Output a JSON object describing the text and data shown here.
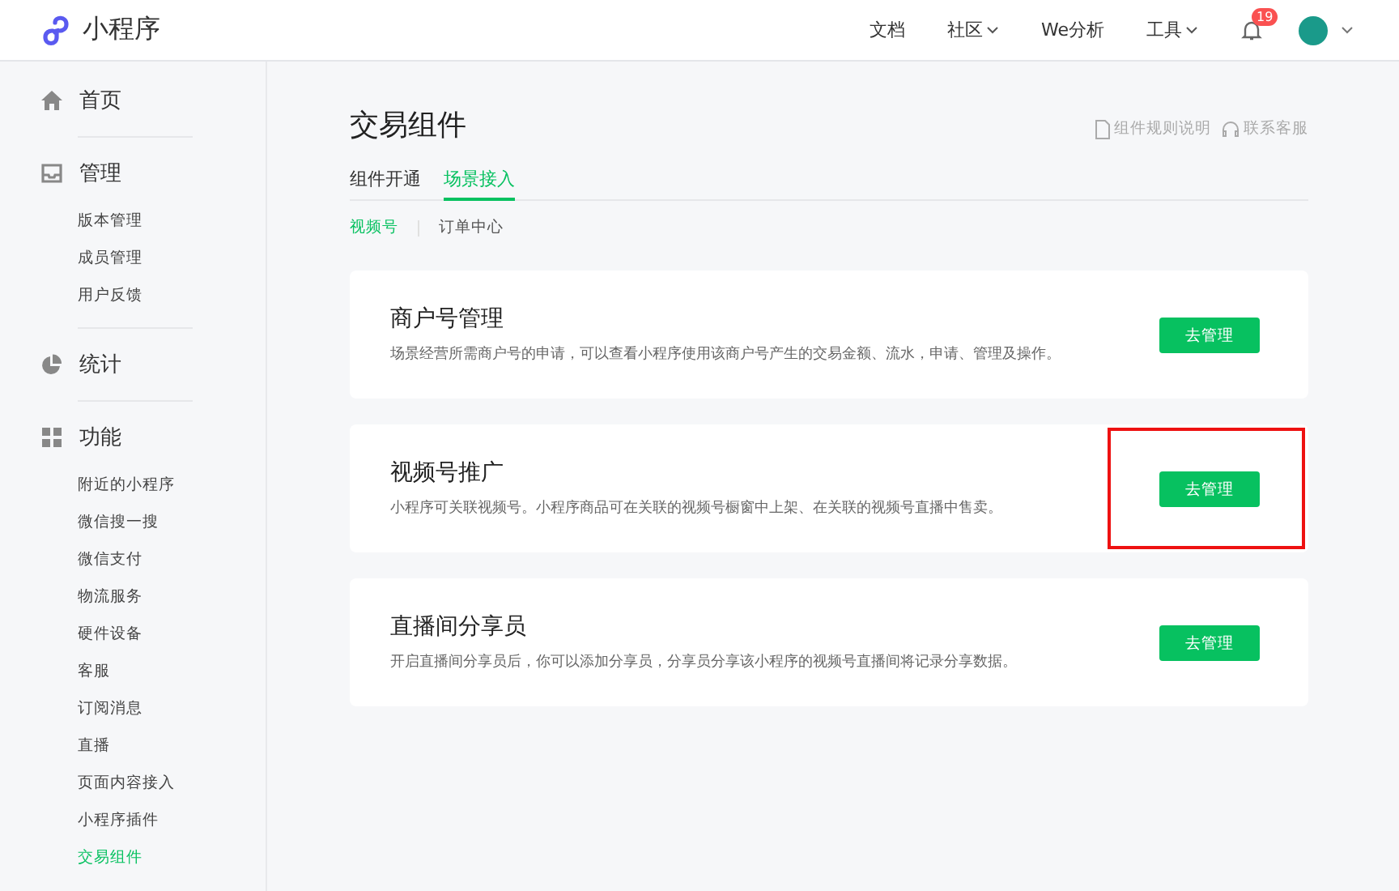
{
  "header": {
    "logo_text": "小程序",
    "nav": [
      {
        "label": "文档",
        "dropdown": false
      },
      {
        "label": "社区",
        "dropdown": true
      },
      {
        "label": "We分析",
        "dropdown": false
      },
      {
        "label": "工具",
        "dropdown": true
      }
    ],
    "notification_count": "19"
  },
  "sidebar": {
    "groups": [
      {
        "title": "首页"
      },
      {
        "title": "管理",
        "items": [
          {
            "label": "版本管理",
            "selected": false
          },
          {
            "label": "成员管理",
            "selected": false
          },
          {
            "label": "用户反馈",
            "selected": false
          }
        ]
      },
      {
        "title": "统计"
      },
      {
        "title": "功能",
        "items": [
          {
            "label": "附近的小程序",
            "selected": false
          },
          {
            "label": "微信搜一搜",
            "selected": false
          },
          {
            "label": "微信支付",
            "selected": false
          },
          {
            "label": "物流服务",
            "selected": false
          },
          {
            "label": "硬件设备",
            "selected": false
          },
          {
            "label": "客服",
            "selected": false
          },
          {
            "label": "订阅消息",
            "selected": false
          },
          {
            "label": "直播",
            "selected": false
          },
          {
            "label": "页面内容接入",
            "selected": false
          },
          {
            "label": "小程序插件",
            "selected": false
          },
          {
            "label": "交易组件",
            "selected": true
          }
        ]
      }
    ]
  },
  "page": {
    "title": "交易组件",
    "links": [
      "组件规则说明",
      "联系客服"
    ],
    "tabs": [
      {
        "label": "组件开通",
        "selected": false
      },
      {
        "label": "场景接入",
        "selected": true
      }
    ],
    "subtabs": [
      {
        "label": "视频号",
        "selected": true
      },
      {
        "label": "订单中心",
        "selected": false
      }
    ],
    "cards": [
      {
        "title": "商户号管理",
        "description": "场景经营所需商户号的申请，可以查看小程序使用该商户号产生的交易金额、流水，申请、管理及操作。",
        "button": "去管理",
        "highlighted": false
      },
      {
        "title": "视频号推广",
        "description": "小程序可关联视频号。小程序商品可在关联的视频号橱窗中上架、在关联的视频号直播中售卖。",
        "button": "去管理",
        "highlighted": true
      },
      {
        "title": "直播间分享员",
        "description": "开启直播间分享员后，你可以添加分享员，分享员分享该小程序的视频号直播间将记录分享数据。",
        "button": "去管理",
        "highlighted": false
      }
    ]
  }
}
